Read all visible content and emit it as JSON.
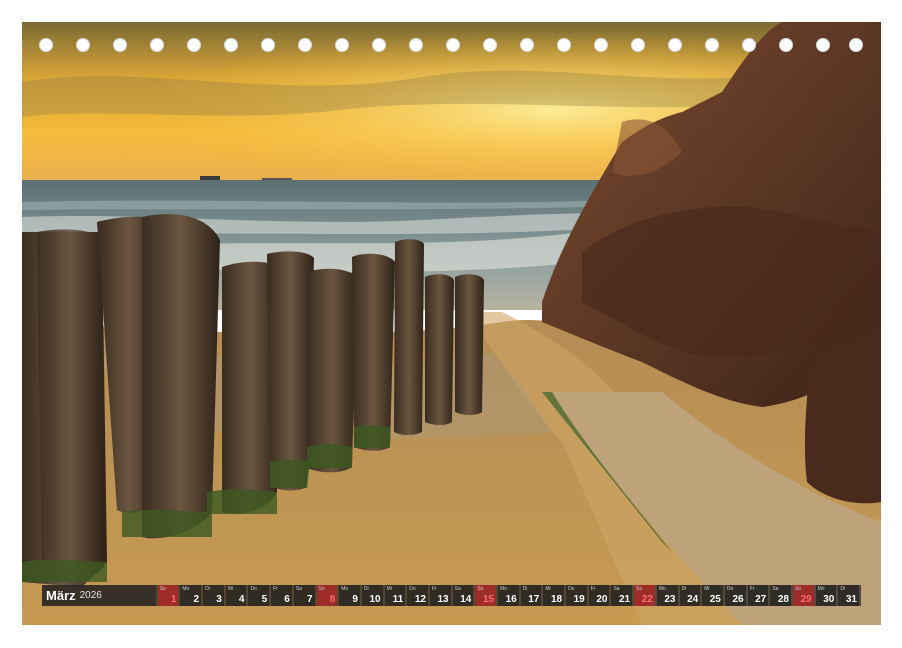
{
  "calendar": {
    "month": "März",
    "year": "2026",
    "days": [
      {
        "n": "1",
        "wd": "So",
        "sun": true
      },
      {
        "n": "2",
        "wd": "Mo"
      },
      {
        "n": "3",
        "wd": "Di"
      },
      {
        "n": "4",
        "wd": "Mi"
      },
      {
        "n": "5",
        "wd": "Do"
      },
      {
        "n": "6",
        "wd": "Fr"
      },
      {
        "n": "7",
        "wd": "Sa"
      },
      {
        "n": "8",
        "wd": "So",
        "sun": true
      },
      {
        "n": "9",
        "wd": "Mo"
      },
      {
        "n": "10",
        "wd": "Di"
      },
      {
        "n": "11",
        "wd": "Mi"
      },
      {
        "n": "12",
        "wd": "Do"
      },
      {
        "n": "13",
        "wd": "Fr"
      },
      {
        "n": "14",
        "wd": "Sa"
      },
      {
        "n": "15",
        "wd": "So",
        "sun": true
      },
      {
        "n": "16",
        "wd": "Mo"
      },
      {
        "n": "17",
        "wd": "Di"
      },
      {
        "n": "18",
        "wd": "Mi"
      },
      {
        "n": "19",
        "wd": "Do"
      },
      {
        "n": "20",
        "wd": "Fr"
      },
      {
        "n": "21",
        "wd": "Sa"
      },
      {
        "n": "22",
        "wd": "So",
        "sun": true
      },
      {
        "n": "23",
        "wd": "Mo"
      },
      {
        "n": "24",
        "wd": "Di"
      },
      {
        "n": "25",
        "wd": "Mi"
      },
      {
        "n": "26",
        "wd": "Do"
      },
      {
        "n": "27",
        "wd": "Fr"
      },
      {
        "n": "28",
        "wd": "Sa"
      },
      {
        "n": "29",
        "wd": "So",
        "sun": true
      },
      {
        "n": "30",
        "wd": "Mo"
      },
      {
        "n": "31",
        "wd": "Di"
      }
    ]
  },
  "colors": {
    "sky_top": "#8a7a3a",
    "sky_glow": "#f4b22a",
    "sea": "#6f8285",
    "sand": "#c79a52",
    "rock": "#5a3222",
    "post": "#4a3a2a",
    "sunday": "#c03030"
  }
}
